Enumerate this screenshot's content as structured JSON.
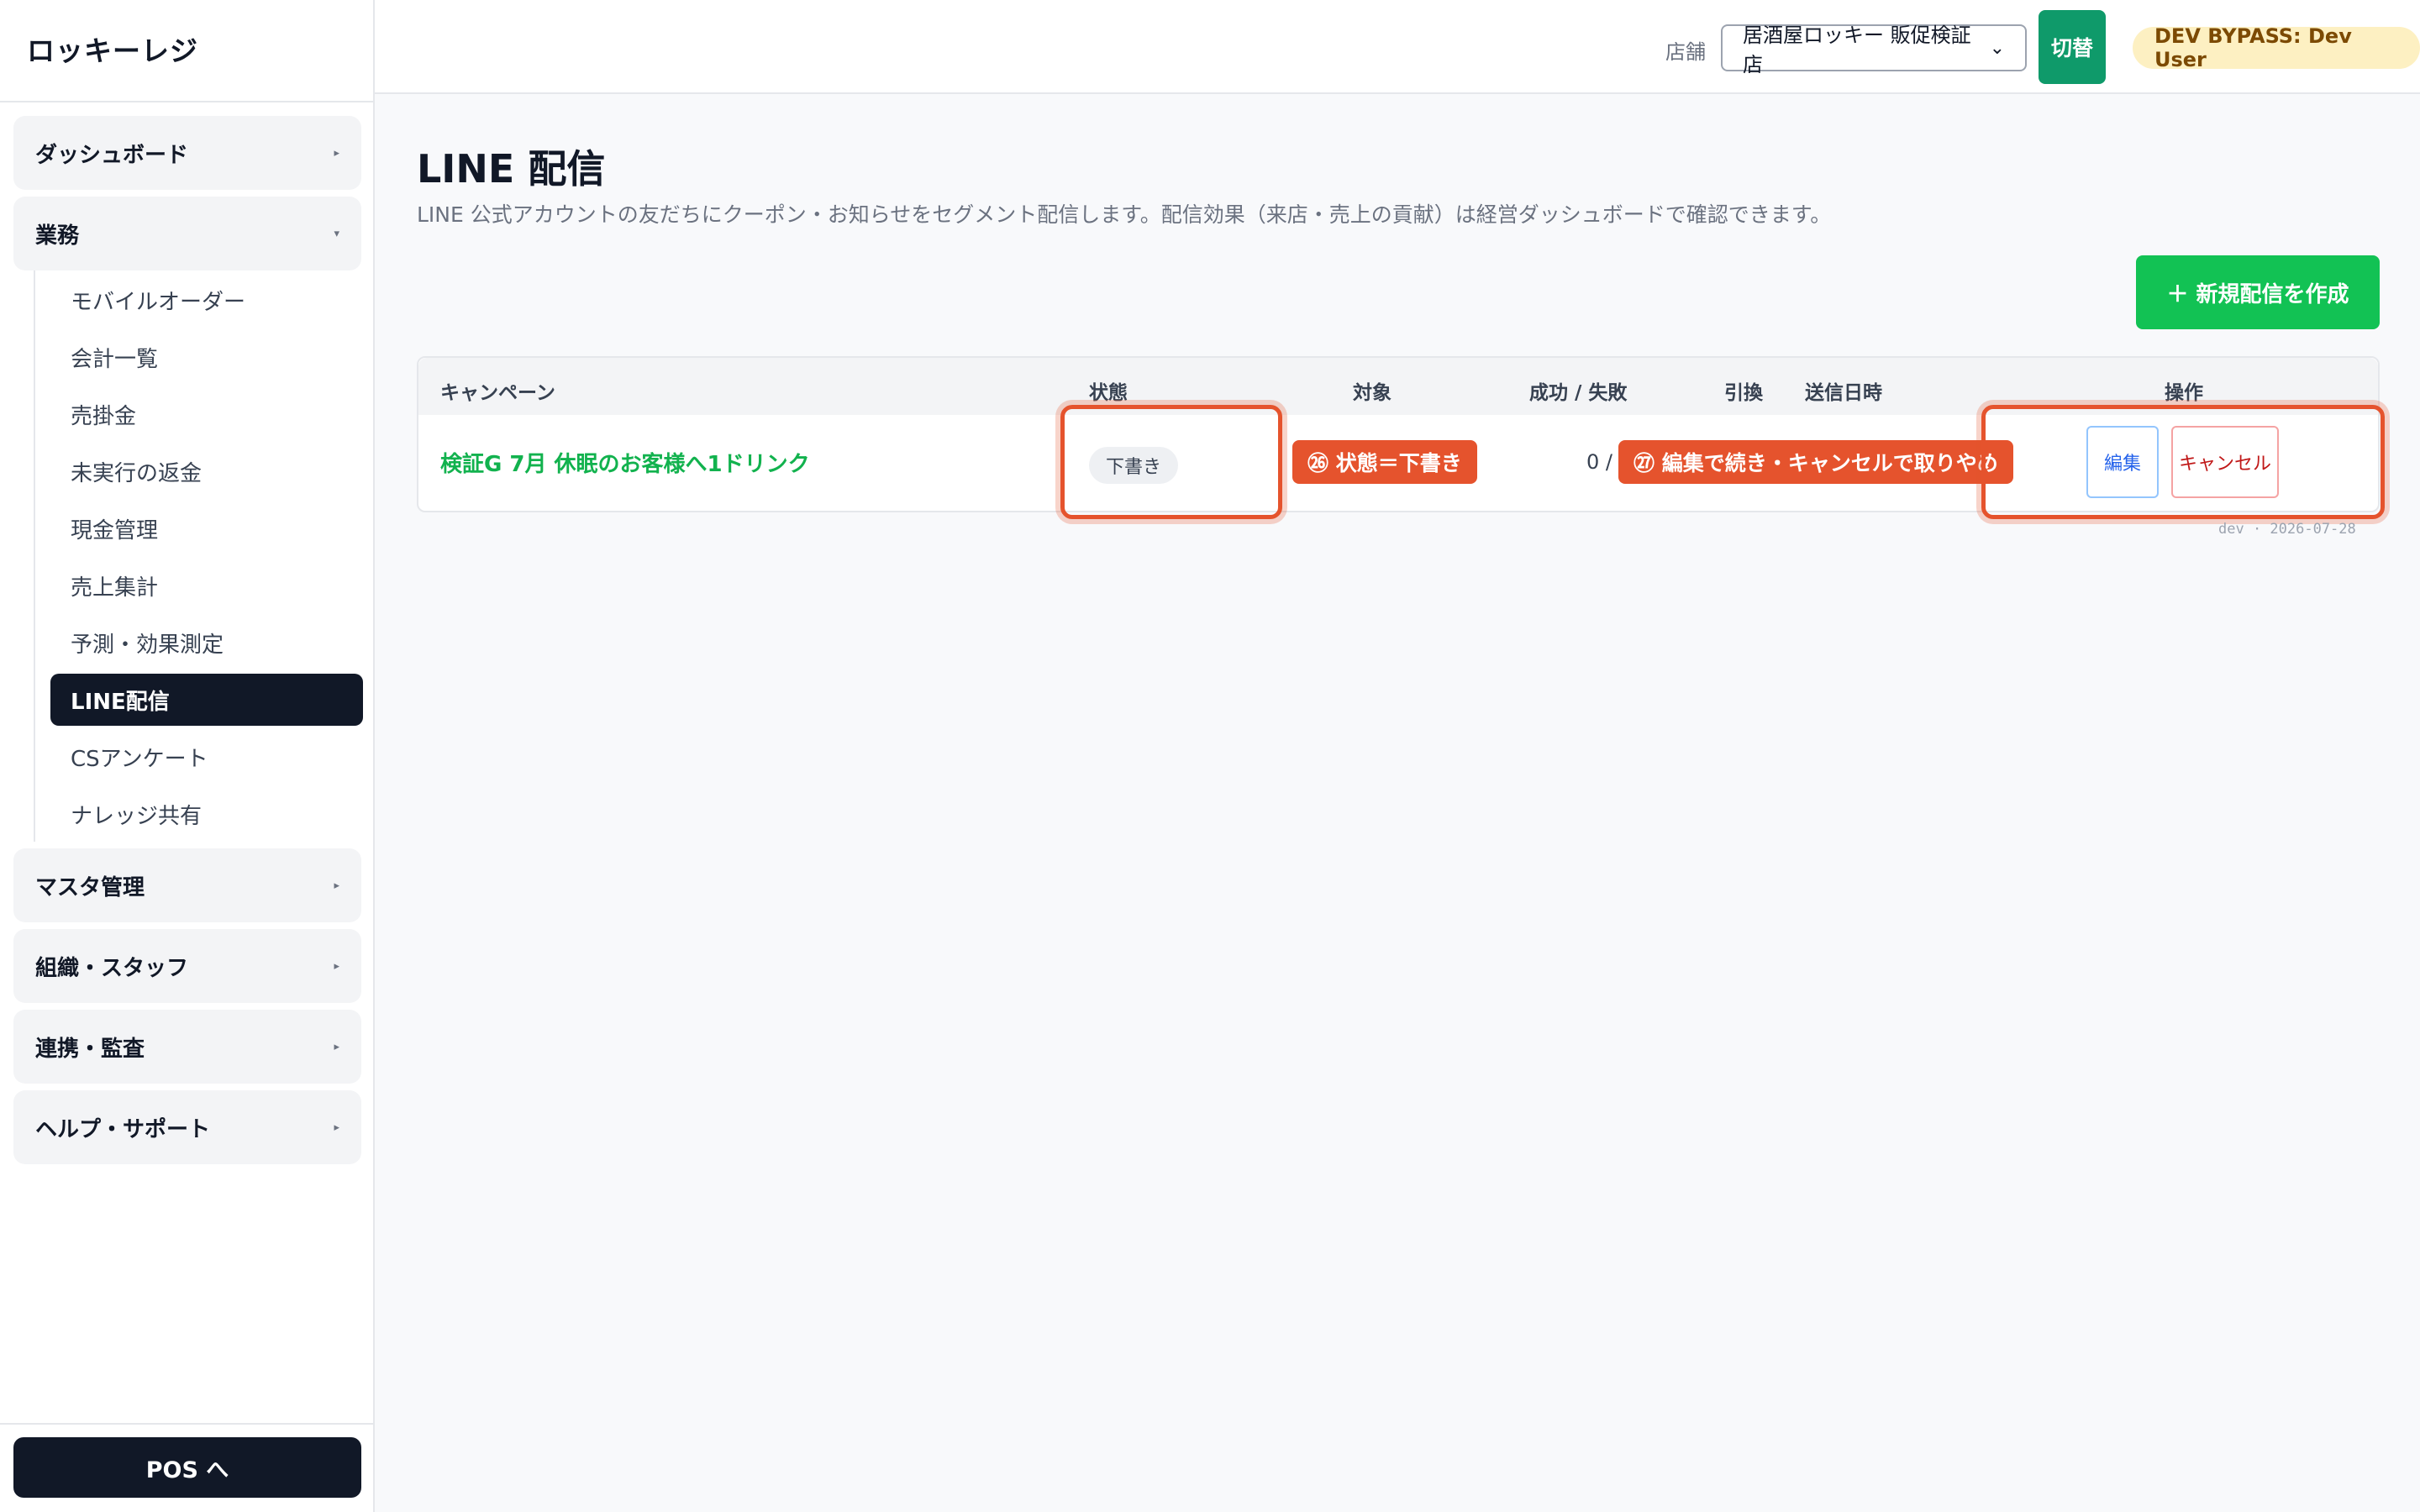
{
  "sidebar": {
    "brand": "ロッキーレジ",
    "groups": {
      "dashboard": "ダッシュボード",
      "operations": "業務",
      "master": "マスタ管理",
      "org_staff": "組織・スタッフ",
      "integration": "連携・監査",
      "help": "ヘルプ・サポート"
    },
    "operations_items": [
      "モバイルオーダー",
      "会計一覧",
      "売掛金",
      "未実行の返金",
      "現金管理",
      "売上集計",
      "予測・効果測定",
      "LINE配信",
      "CSアンケート",
      "ナレッジ共有"
    ],
    "active_item": "LINE配信",
    "pos_button": "POS へ"
  },
  "topbar": {
    "store_label": "店舗",
    "store_selected": "居酒屋ロッキー 販促検証店",
    "switch_button": "切替",
    "user_badge": "DEV BYPASS: Dev User"
  },
  "page": {
    "title": "LINE 配信",
    "description": "LINE 公式アカウントの友だちにクーポン・お知らせをセグメント配信します。配信効果（来店・売上の貢献）は経営ダッシュボードで確認できます。",
    "new_button": "＋ 新規配信を作成"
  },
  "table": {
    "headers": {
      "campaign": "キャンペーン",
      "status": "状態",
      "target": "対象",
      "success_fail": "成功 / 失敗",
      "redeemed": "引換",
      "sent_at": "送信日時",
      "actions": "操作"
    },
    "rows": [
      {
        "campaign": "検証G 7月 休眠のお客様へ1ドリンク",
        "status": "下書き",
        "success_fail": "0 /",
        "edit": "編集",
        "cancel": "キャンセル"
      }
    ]
  },
  "annotations": {
    "tag_26": "㉖ 状態＝下書き",
    "tag_27": "㉗ 編集で続き・キャンセルで取りやめ"
  },
  "footnote": "dev · 2026-07-28",
  "colors": {
    "accent_green": "#12c254",
    "switch_green": "#0f9a6a",
    "annotation_orange": "#e5532d",
    "active_nav": "#111827"
  }
}
